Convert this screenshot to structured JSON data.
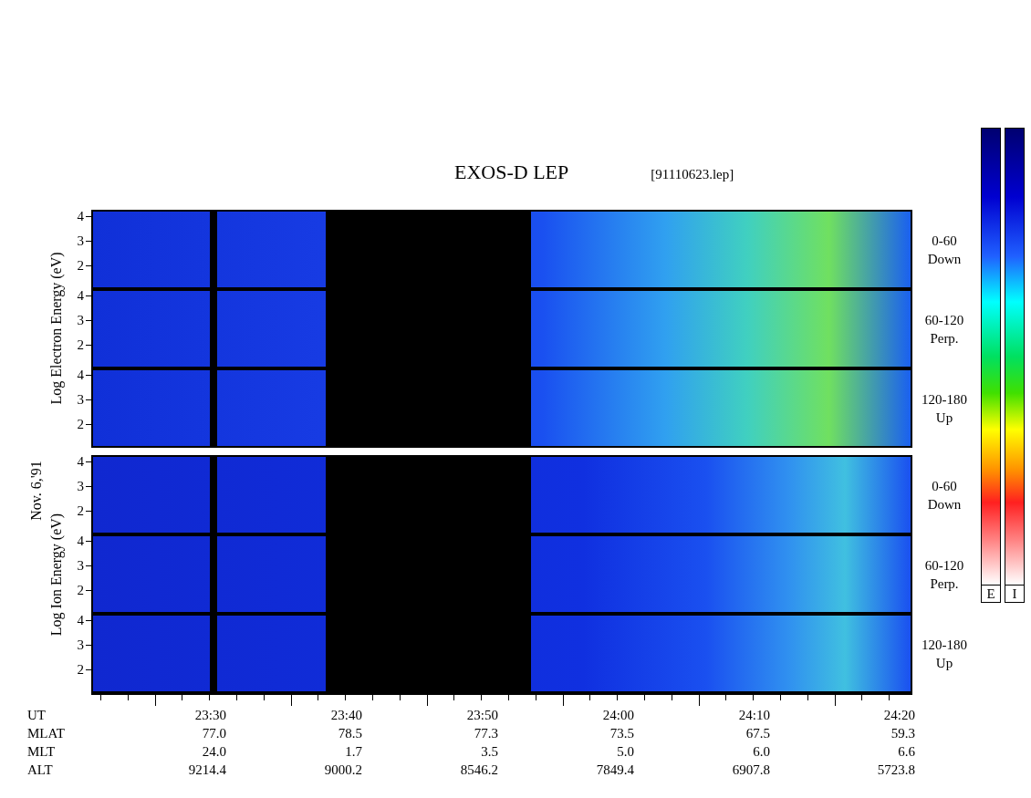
{
  "title": "EXOS-D LEP",
  "file": "[91110623.lep]",
  "date_label": "Nov. 6,'91",
  "groups": [
    {
      "axis_label": "Log Electron Energy (eV)",
      "panels": [
        {
          "ticks": [
            "4",
            "3",
            "2"
          ],
          "angle": "0-60",
          "direction": "Down"
        },
        {
          "ticks": [
            "4",
            "3",
            "2"
          ],
          "angle": "60-120",
          "direction": "Perp."
        },
        {
          "ticks": [
            "4",
            "3",
            "2"
          ],
          "angle": "120-180",
          "direction": "Up"
        }
      ]
    },
    {
      "axis_label": "Log Ion Energy (eV)",
      "panels": [
        {
          "ticks": [
            "4",
            "3",
            "2"
          ],
          "angle": "0-60",
          "direction": "Down"
        },
        {
          "ticks": [
            "4",
            "3",
            "2"
          ],
          "angle": "60-120",
          "direction": "Perp."
        },
        {
          "ticks": [
            "4",
            "3",
            "2"
          ],
          "angle": "120-180",
          "direction": "Up"
        }
      ]
    }
  ],
  "colorbars": [
    {
      "label": "E"
    },
    {
      "label": "I"
    }
  ],
  "table": [
    {
      "label": "UT",
      "values": [
        "23:30",
        "23:40",
        "23:50",
        "24:00",
        "24:10",
        "24:20"
      ]
    },
    {
      "label": "MLAT",
      "values": [
        "77.0",
        "78.5",
        "77.3",
        "73.5",
        "67.5",
        "59.3"
      ]
    },
    {
      "label": "MLT",
      "values": [
        "24.0",
        "1.7",
        "3.5",
        "5.0",
        "6.0",
        "6.6"
      ]
    },
    {
      "label": "ALT",
      "values": [
        "9214.4",
        "9000.2",
        "8546.2",
        "7849.4",
        "6907.8",
        "5723.8"
      ]
    }
  ]
}
